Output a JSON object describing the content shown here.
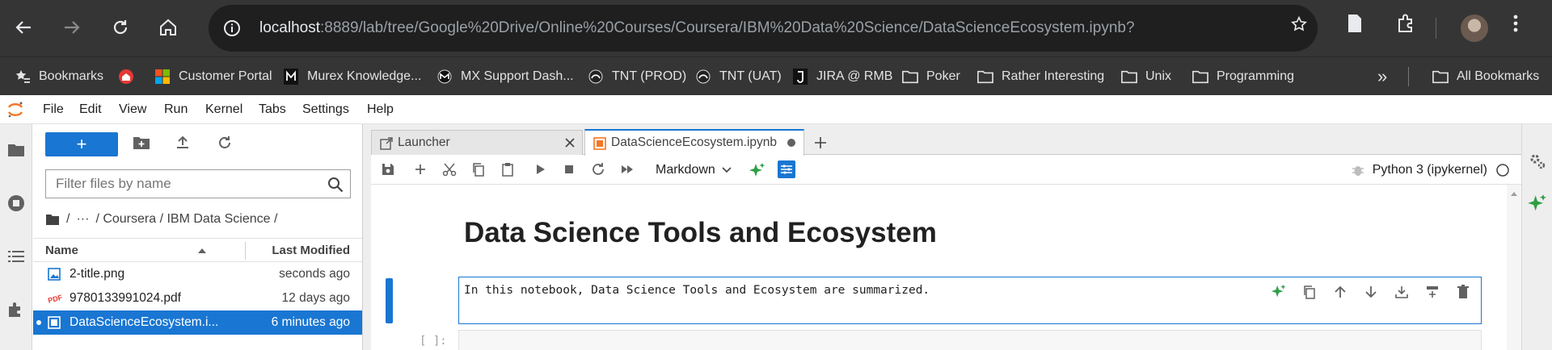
{
  "browser": {
    "url_host": "localhost",
    "url_rest": ":8889/lab/tree/Google%20Drive/Online%20Courses/Coursera/IBM%20Data%20Science/DataScienceEcosystem.ipynb?",
    "bookmarks": [
      {
        "label": "Bookmarks",
        "icon": "star-list-icon"
      },
      {
        "label": "",
        "icon": "red-home-icon"
      },
      {
        "label": "Customer Portal",
        "icon": "microsoft-icon"
      },
      {
        "label": "Murex Knowledge...",
        "icon": "murex-icon"
      },
      {
        "label": "MX Support Dash...",
        "icon": "mx-icon"
      },
      {
        "label": "TNT (PROD)",
        "icon": "tnt-icon"
      },
      {
        "label": "TNT (UAT)",
        "icon": "tnt-icon"
      },
      {
        "label": "JIRA @ RMB",
        "icon": "jira-icon"
      },
      {
        "label": "Poker",
        "icon": "folder-icon"
      },
      {
        "label": "Rather Interesting",
        "icon": "folder-icon"
      },
      {
        "label": "Unix",
        "icon": "folder-icon"
      },
      {
        "label": "Programming",
        "icon": "folder-icon"
      }
    ],
    "more_label": "»",
    "all_bookmarks": "All Bookmarks"
  },
  "menu": [
    "File",
    "Edit",
    "View",
    "Run",
    "Kernel",
    "Tabs",
    "Settings",
    "Help"
  ],
  "filebrowser": {
    "new_label": "+",
    "filter_placeholder": "Filter files by name",
    "breadcrumb": [
      "/",
      "···",
      "/ Coursera / IBM Data Science /"
    ],
    "col_name": "Name",
    "col_modified": "Last Modified",
    "files": [
      {
        "name": "2-title.png",
        "modified": "seconds ago",
        "type": "image"
      },
      {
        "name": "9780133991024.pdf",
        "modified": "12 days ago",
        "type": "pdf"
      },
      {
        "name": "DataScienceEcosystem.i...",
        "modified": "6 minutes ago",
        "type": "notebook",
        "selected": true
      }
    ]
  },
  "tabs": [
    {
      "label": "Launcher",
      "active": false
    },
    {
      "label": "DataScienceEcosystem.ipynb",
      "active": true
    }
  ],
  "notebook": {
    "cell_type": "Markdown",
    "kernel": "Python 3 (ipykernel)",
    "heading": "Data Science Tools and Ecosystem",
    "cell_text": "In this notebook, Data Science Tools and Ecosystem are summarized.",
    "next_prompt": "[ ]:"
  },
  "colors": {
    "accent": "#1976d2",
    "chrome": "#353535"
  }
}
